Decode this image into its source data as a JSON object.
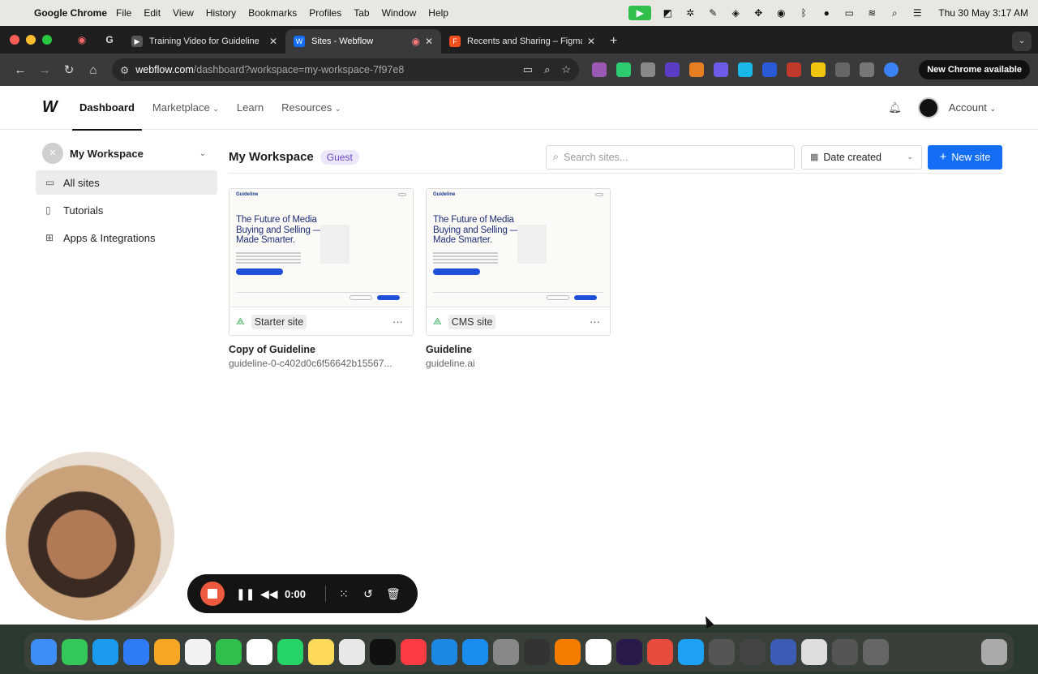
{
  "menubar": {
    "app": "Google Chrome",
    "items": [
      "File",
      "Edit",
      "View",
      "History",
      "Bookmarks",
      "Profiles",
      "Tab",
      "Window",
      "Help"
    ],
    "clock": "Thu 30 May  3:17 AM"
  },
  "tabs": [
    {
      "title": "Training Video for Guideline",
      "favicon_color": "#444444"
    },
    {
      "title": "Sites - Webflow",
      "favicon_color": "#146ef5",
      "active": true
    },
    {
      "title": "Recents and Sharing – Figma",
      "favicon_color": "#f24e1e"
    }
  ],
  "address": {
    "host": "webflow.com",
    "path": "/dashboard?workspace=my-workspace-7f97e8",
    "update_label": "New Chrome available"
  },
  "topnav": {
    "dashboard": "Dashboard",
    "marketplace": "Marketplace",
    "learn": "Learn",
    "resources": "Resources",
    "account": "Account"
  },
  "sidebar": {
    "workspace_name": "My Workspace",
    "items": [
      {
        "label": "All sites",
        "icon": "folder-icon"
      },
      {
        "label": "Tutorials",
        "icon": "book-icon"
      },
      {
        "label": "Apps & Integrations",
        "icon": "apps-icon"
      }
    ]
  },
  "main": {
    "title": "My Workspace",
    "role_badge": "Guest",
    "search_placeholder": "Search sites...",
    "sort_label": "Date created",
    "new_site_label": "New site"
  },
  "sites": [
    {
      "name": "Copy of Guideline",
      "url": "guideline-0-c402d0c6f56642b15567...",
      "plan": "Starter site",
      "thumb_logo": "Guideline",
      "thumb_heading": "The Future of Media Buying and Selling —Made Smarter."
    },
    {
      "name": "Guideline",
      "url": "guideline.ai",
      "plan": "CMS site",
      "thumb_logo": "Guideline",
      "thumb_heading": "The Future of Media Buying and Selling —Made Smarter."
    }
  ],
  "recorder": {
    "time": "0:00"
  },
  "colors": {
    "accent": "#146ef5",
    "badge_bg": "#ece6fb",
    "badge_text": "#6b49c8",
    "record": "#ee5a3d"
  }
}
